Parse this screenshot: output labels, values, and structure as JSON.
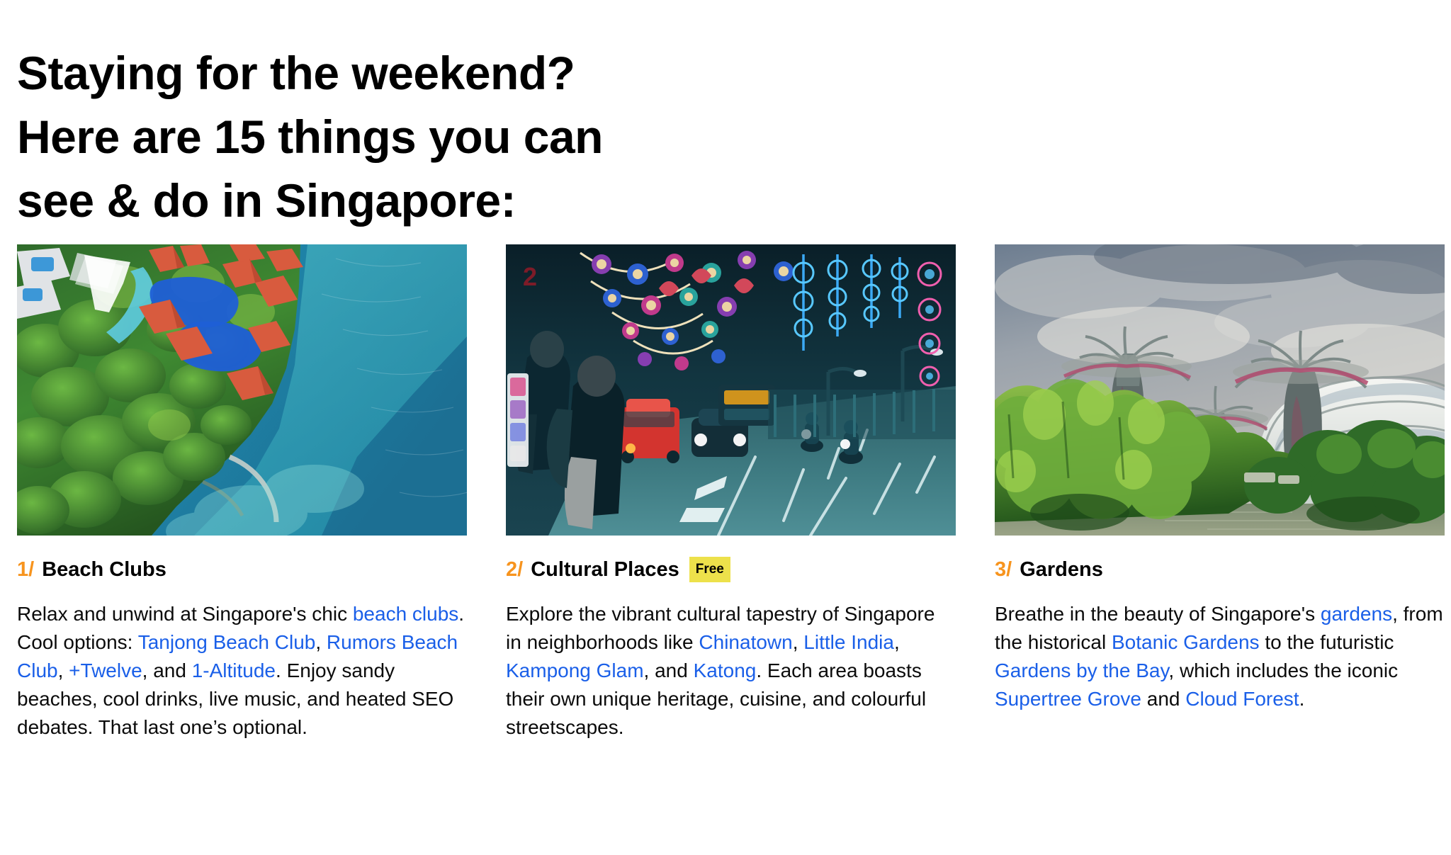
{
  "headline": "Staying for the weekend?\nHere are 15 things you can\nsee & do in Singapore:",
  "colors": {
    "accent_orange": "#F7941E",
    "link_blue": "#1A5FE8",
    "badge_yellow": "#EDE14B",
    "text_black": "#000000",
    "background": "#FFFFFF"
  },
  "cards": [
    {
      "number": "1/",
      "title": "Beach Clubs",
      "badge": null,
      "image_alt": "aerial-view-resort-coastline-turquoise-sea",
      "body_segments": [
        {
          "type": "text",
          "text": "Relax and unwind at Singapore's chic "
        },
        {
          "type": "link",
          "text": "beach clubs"
        },
        {
          "type": "text",
          "text": ". Cool options: "
        },
        {
          "type": "link",
          "text": "Tanjong Beach Club"
        },
        {
          "type": "text",
          "text": ", "
        },
        {
          "type": "link",
          "text": "Rumors Beach Club"
        },
        {
          "type": "text",
          "text": ", "
        },
        {
          "type": "link",
          "text": "+Twelve"
        },
        {
          "type": "text",
          "text": ", and "
        },
        {
          "type": "link",
          "text": "1-Altitude"
        },
        {
          "type": "text",
          "text": ". Enjoy sandy beaches, cool drinks, live music, and heated SEO debates. That last one’s optional."
        }
      ]
    },
    {
      "number": "2/",
      "title": "Cultural Places",
      "badge": "Free",
      "image_alt": "little-india-street-at-night-with-festival-lights",
      "body_segments": [
        {
          "type": "text",
          "text": "Explore the vibrant cultural tapestry of Singapore in neighborhoods like "
        },
        {
          "type": "link",
          "text": "Chinatown"
        },
        {
          "type": "text",
          "text": ", "
        },
        {
          "type": "link",
          "text": "Little India"
        },
        {
          "type": "text",
          "text": ", "
        },
        {
          "type": "link",
          "text": "Kampong Glam"
        },
        {
          "type": "text",
          "text": ", and "
        },
        {
          "type": "link",
          "text": "Katong"
        },
        {
          "type": "text",
          "text": ". Each area boasts their own unique heritage, cuisine, and colourful streetscapes."
        }
      ]
    },
    {
      "number": "3/",
      "title": "Gardens",
      "badge": null,
      "image_alt": "gardens-by-the-bay-supertree-grove-and-conservatory",
      "body_segments": [
        {
          "type": "text",
          "text": "Breathe in the beauty of Singapore's "
        },
        {
          "type": "link",
          "text": "gardens"
        },
        {
          "type": "text",
          "text": ", from the historical "
        },
        {
          "type": "link",
          "text": "Botanic Gardens"
        },
        {
          "type": "text",
          "text": " to the futuristic "
        },
        {
          "type": "link",
          "text": "Gardens by the Bay"
        },
        {
          "type": "text",
          "text": ", which includes the iconic "
        },
        {
          "type": "link",
          "text": "Supertree Grove"
        },
        {
          "type": "text",
          "text": " and "
        },
        {
          "type": "link",
          "text": "Cloud Forest"
        },
        {
          "type": "text",
          "text": "."
        }
      ]
    }
  ]
}
